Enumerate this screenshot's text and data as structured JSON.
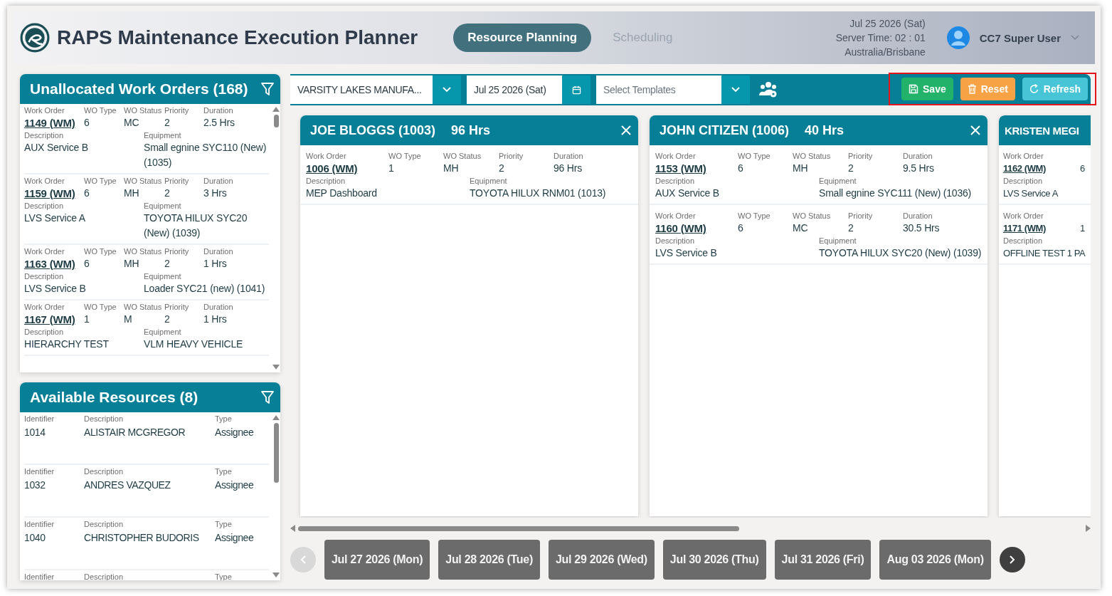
{
  "header": {
    "title": "RAPS Maintenance Execution Planner",
    "tabs": [
      {
        "label": "Resource Planning",
        "selected": true
      },
      {
        "label": "Scheduling",
        "selected": false
      }
    ],
    "server_info": [
      "Jul 25 2026 (Sat)",
      "Server Time: 02 : 01",
      "Australia/Brisbane"
    ],
    "user": "CC7 Super User"
  },
  "unallocated": {
    "title": "Unallocated Work Orders (168)",
    "items": [
      {
        "top": [
          {
            "label": "Work Order",
            "value": "1149 (WM)",
            "kind": "link"
          },
          {
            "label": "WO Type",
            "value": "6"
          },
          {
            "label": "WO Status",
            "value": "MC"
          },
          {
            "label": "Priority",
            "value": "2"
          },
          {
            "label": "Duration",
            "value": "2.5 Hrs"
          }
        ],
        "bottom": [
          {
            "label": "Description",
            "value": "AUX Service B"
          },
          {
            "label": "Equipment",
            "value": "Small egnine SYC110 (New) (1035)"
          }
        ]
      },
      {
        "top": [
          {
            "label": "Work Order",
            "value": "1159 (WM)",
            "kind": "link"
          },
          {
            "label": "WO Type",
            "value": "6"
          },
          {
            "label": "WO Status",
            "value": "MH"
          },
          {
            "label": "Priority",
            "value": "2"
          },
          {
            "label": "Duration",
            "value": "3 Hrs"
          }
        ],
        "bottom": [
          {
            "label": "Description",
            "value": "LVS Service A"
          },
          {
            "label": "Equipment",
            "value": "TOYOTA HILUX SYC20 (New) (1039)"
          }
        ]
      },
      {
        "top": [
          {
            "label": "Work Order",
            "value": "1163 (WM)",
            "kind": "link"
          },
          {
            "label": "WO Type",
            "value": "6"
          },
          {
            "label": "WO Status",
            "value": "MH"
          },
          {
            "label": "Priority",
            "value": "2"
          },
          {
            "label": "Duration",
            "value": "1 Hrs"
          }
        ],
        "bottom": [
          {
            "label": "Description",
            "value": "LVS Service B"
          },
          {
            "label": "Equipment",
            "value": "Loader SYC21 (new) (1041)"
          }
        ]
      },
      {
        "top": [
          {
            "label": "Work Order",
            "value": "1167 (WM)",
            "kind": "link"
          },
          {
            "label": "WO Type",
            "value": "1"
          },
          {
            "label": "WO Status",
            "value": "M"
          },
          {
            "label": "Priority",
            "value": "2"
          },
          {
            "label": "Duration",
            "value": "1 Hrs"
          }
        ],
        "bottom": [
          {
            "label": "Description",
            "value": "HIERARCHY TEST"
          },
          {
            "label": "Equipment",
            "value": "VLM HEAVY VEHICLE"
          }
        ]
      }
    ]
  },
  "resources": {
    "title": "Available Resources (8)",
    "items": [
      {
        "fields": [
          {
            "label": "Identifier",
            "value": "1014"
          },
          {
            "label": "Description",
            "value": "ALISTAIR MCGREGOR"
          },
          {
            "label": "Type",
            "value": "Assignee"
          }
        ]
      },
      {
        "fields": [
          {
            "label": "Identifier",
            "value": "1032"
          },
          {
            "label": "Description",
            "value": "ANDRES VAZQUEZ"
          },
          {
            "label": "Type",
            "value": "Assignee"
          }
        ]
      },
      {
        "fields": [
          {
            "label": "Identifier",
            "value": "1040"
          },
          {
            "label": "Description",
            "value": "CHRISTOPHER BUDORIS"
          },
          {
            "label": "Type",
            "value": "Assignee"
          }
        ]
      },
      {
        "fields": [
          {
            "label": "Identifier"
          },
          {
            "label": "Description"
          },
          {
            "label": "Type"
          }
        ]
      }
    ]
  },
  "toolbar": {
    "site": "VARSITY LAKES MANUFA...",
    "date": "Jul 25 2026 (Sat)",
    "templates_placeholder": "Select Templates",
    "buttons": [
      {
        "label": "Save",
        "kind": "save"
      },
      {
        "label": "Reset",
        "kind": "reset"
      },
      {
        "label": "Refresh",
        "kind": "refresh"
      }
    ]
  },
  "cards": [
    {
      "name": "JOE BLOGGS (1003)",
      "hours": "96 Hrs",
      "kind": "full",
      "items": [
        {
          "top": [
            {
              "label": "Work Order",
              "value": "1006 (WM)",
              "kind": "link"
            },
            {
              "label": "WO Type",
              "value": "1"
            },
            {
              "label": "WO Status",
              "value": "MH"
            },
            {
              "label": "Priority",
              "value": "2"
            },
            {
              "label": "Duration",
              "value": "96 Hrs"
            }
          ],
          "bottom": [
            {
              "label": "Description",
              "value": "MEP Dashboard"
            },
            {
              "label": "Equipment",
              "value": "TOYOTA HILUX RNM01 (1013)"
            }
          ]
        }
      ]
    },
    {
      "name": "JOHN CITIZEN (1006)",
      "hours": "40 Hrs",
      "kind": "full",
      "items": [
        {
          "top": [
            {
              "label": "Work Order",
              "value": "1153 (WM)",
              "kind": "link"
            },
            {
              "label": "WO Type",
              "value": "6"
            },
            {
              "label": "WO Status",
              "value": "MH"
            },
            {
              "label": "Priority",
              "value": "2"
            },
            {
              "label": "Duration",
              "value": "9.5 Hrs"
            }
          ],
          "bottom": [
            {
              "label": "Description",
              "value": "AUX Service B"
            },
            {
              "label": "Equipment",
              "value": "Small egnine SYC111 (New) (1036)"
            }
          ]
        },
        {
          "top": [
            {
              "label": "Work Order",
              "value": "1160 (WM)",
              "kind": "link"
            },
            {
              "label": "WO Type",
              "value": "6"
            },
            {
              "label": "WO Status",
              "value": "MC"
            },
            {
              "label": "Priority",
              "value": "2"
            },
            {
              "label": "Duration",
              "value": "30.5 Hrs"
            }
          ],
          "bottom": [
            {
              "label": "Description",
              "value": "LVS Service B"
            },
            {
              "label": "Equipment",
              "value": "TOYOTA HILUX SYC20 (New) (1039)"
            }
          ]
        }
      ]
    },
    {
      "name": "KRISTEN MEGI",
      "kind": "partial",
      "items": [
        {
          "top": [
            {
              "label": "Work Order",
              "value": "1162 (WM)",
              "kind": "link"
            },
            {
              "value": "6"
            }
          ],
          "bottom": [
            {
              "label": "Description",
              "value": "LVS Service A"
            }
          ]
        },
        {
          "top": [
            {
              "label": "Work Order",
              "value": "1171 (WM)",
              "kind": "link"
            },
            {
              "value": "1"
            }
          ],
          "bottom": [
            {
              "label": "Description",
              "value": "OFFLINE TEST 1 PA"
            }
          ]
        }
      ]
    }
  ],
  "date_nav": {
    "prev_disabled": true,
    "dates": [
      "Jul 27 2026 (Mon)",
      "Jul 28 2026 (Tue)",
      "Jul 29 2026 (Wed)",
      "Jul 30 2026 (Thu)",
      "Jul 31 2026 (Fri)",
      "Aug 03 2026 (Mon)"
    ],
    "next_disabled": false
  }
}
